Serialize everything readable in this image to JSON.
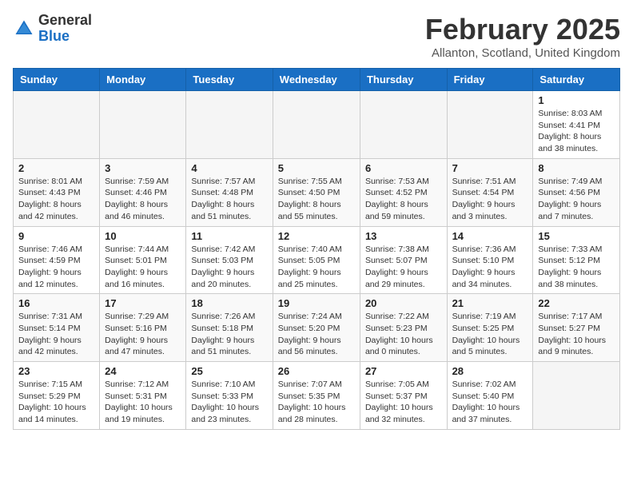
{
  "logo": {
    "general": "General",
    "blue": "Blue"
  },
  "title": "February 2025",
  "location": "Allanton, Scotland, United Kingdom",
  "days_of_week": [
    "Sunday",
    "Monday",
    "Tuesday",
    "Wednesday",
    "Thursday",
    "Friday",
    "Saturday"
  ],
  "weeks": [
    [
      {
        "day": "",
        "info": ""
      },
      {
        "day": "",
        "info": ""
      },
      {
        "day": "",
        "info": ""
      },
      {
        "day": "",
        "info": ""
      },
      {
        "day": "",
        "info": ""
      },
      {
        "day": "",
        "info": ""
      },
      {
        "day": "1",
        "info": "Sunrise: 8:03 AM\nSunset: 4:41 PM\nDaylight: 8 hours\nand 38 minutes."
      }
    ],
    [
      {
        "day": "2",
        "info": "Sunrise: 8:01 AM\nSunset: 4:43 PM\nDaylight: 8 hours\nand 42 minutes."
      },
      {
        "day": "3",
        "info": "Sunrise: 7:59 AM\nSunset: 4:46 PM\nDaylight: 8 hours\nand 46 minutes."
      },
      {
        "day": "4",
        "info": "Sunrise: 7:57 AM\nSunset: 4:48 PM\nDaylight: 8 hours\nand 51 minutes."
      },
      {
        "day": "5",
        "info": "Sunrise: 7:55 AM\nSunset: 4:50 PM\nDaylight: 8 hours\nand 55 minutes."
      },
      {
        "day": "6",
        "info": "Sunrise: 7:53 AM\nSunset: 4:52 PM\nDaylight: 8 hours\nand 59 minutes."
      },
      {
        "day": "7",
        "info": "Sunrise: 7:51 AM\nSunset: 4:54 PM\nDaylight: 9 hours\nand 3 minutes."
      },
      {
        "day": "8",
        "info": "Sunrise: 7:49 AM\nSunset: 4:56 PM\nDaylight: 9 hours\nand 7 minutes."
      }
    ],
    [
      {
        "day": "9",
        "info": "Sunrise: 7:46 AM\nSunset: 4:59 PM\nDaylight: 9 hours\nand 12 minutes."
      },
      {
        "day": "10",
        "info": "Sunrise: 7:44 AM\nSunset: 5:01 PM\nDaylight: 9 hours\nand 16 minutes."
      },
      {
        "day": "11",
        "info": "Sunrise: 7:42 AM\nSunset: 5:03 PM\nDaylight: 9 hours\nand 20 minutes."
      },
      {
        "day": "12",
        "info": "Sunrise: 7:40 AM\nSunset: 5:05 PM\nDaylight: 9 hours\nand 25 minutes."
      },
      {
        "day": "13",
        "info": "Sunrise: 7:38 AM\nSunset: 5:07 PM\nDaylight: 9 hours\nand 29 minutes."
      },
      {
        "day": "14",
        "info": "Sunrise: 7:36 AM\nSunset: 5:10 PM\nDaylight: 9 hours\nand 34 minutes."
      },
      {
        "day": "15",
        "info": "Sunrise: 7:33 AM\nSunset: 5:12 PM\nDaylight: 9 hours\nand 38 minutes."
      }
    ],
    [
      {
        "day": "16",
        "info": "Sunrise: 7:31 AM\nSunset: 5:14 PM\nDaylight: 9 hours\nand 42 minutes."
      },
      {
        "day": "17",
        "info": "Sunrise: 7:29 AM\nSunset: 5:16 PM\nDaylight: 9 hours\nand 47 minutes."
      },
      {
        "day": "18",
        "info": "Sunrise: 7:26 AM\nSunset: 5:18 PM\nDaylight: 9 hours\nand 51 minutes."
      },
      {
        "day": "19",
        "info": "Sunrise: 7:24 AM\nSunset: 5:20 PM\nDaylight: 9 hours\nand 56 minutes."
      },
      {
        "day": "20",
        "info": "Sunrise: 7:22 AM\nSunset: 5:23 PM\nDaylight: 10 hours\nand 0 minutes."
      },
      {
        "day": "21",
        "info": "Sunrise: 7:19 AM\nSunset: 5:25 PM\nDaylight: 10 hours\nand 5 minutes."
      },
      {
        "day": "22",
        "info": "Sunrise: 7:17 AM\nSunset: 5:27 PM\nDaylight: 10 hours\nand 9 minutes."
      }
    ],
    [
      {
        "day": "23",
        "info": "Sunrise: 7:15 AM\nSunset: 5:29 PM\nDaylight: 10 hours\nand 14 minutes."
      },
      {
        "day": "24",
        "info": "Sunrise: 7:12 AM\nSunset: 5:31 PM\nDaylight: 10 hours\nand 19 minutes."
      },
      {
        "day": "25",
        "info": "Sunrise: 7:10 AM\nSunset: 5:33 PM\nDaylight: 10 hours\nand 23 minutes."
      },
      {
        "day": "26",
        "info": "Sunrise: 7:07 AM\nSunset: 5:35 PM\nDaylight: 10 hours\nand 28 minutes."
      },
      {
        "day": "27",
        "info": "Sunrise: 7:05 AM\nSunset: 5:37 PM\nDaylight: 10 hours\nand 32 minutes."
      },
      {
        "day": "28",
        "info": "Sunrise: 7:02 AM\nSunset: 5:40 PM\nDaylight: 10 hours\nand 37 minutes."
      },
      {
        "day": "",
        "info": ""
      }
    ]
  ]
}
